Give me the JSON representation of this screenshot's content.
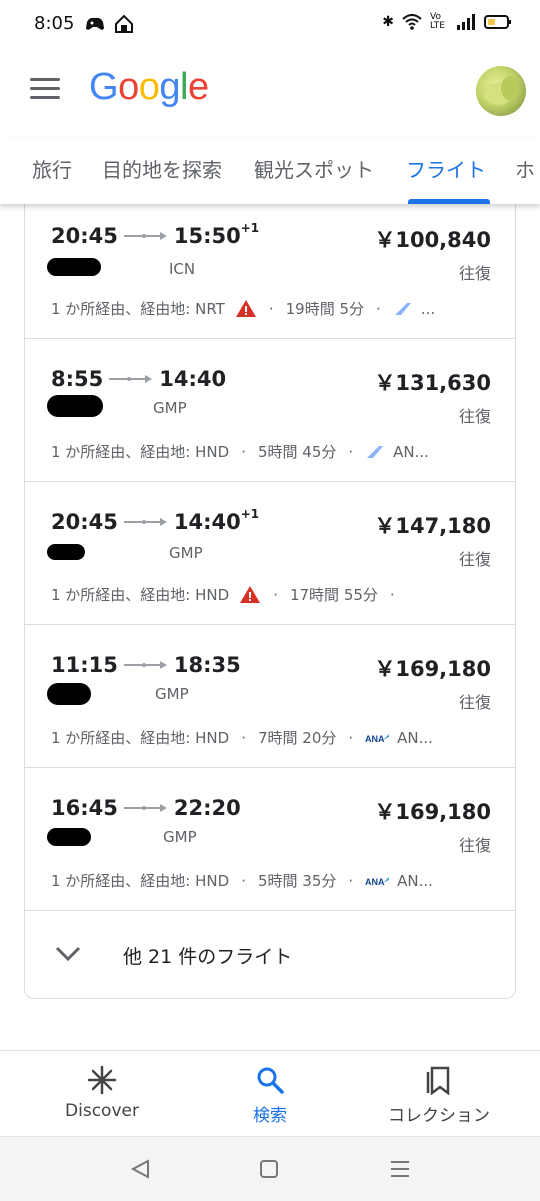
{
  "status_bar": {
    "time": "8:05",
    "network": "Vo LTE"
  },
  "app": {
    "logo_text": [
      "G",
      "o",
      "o",
      "g",
      "l",
      "e"
    ],
    "logo_colors": [
      "#4285F4",
      "#EA4335",
      "#FBBC05",
      "#4285F4",
      "#34A853",
      "#EA4335"
    ]
  },
  "tabs": [
    "旅行",
    "目的地を探索",
    "観光スポット",
    "フライト",
    "ホ"
  ],
  "active_tab": "フライト",
  "flights": [
    {
      "depart": "20:45",
      "arrive": "15:50",
      "plus": "+1",
      "price": "￥100,840",
      "airport": "ICN",
      "trip": "往復",
      "stops": "1 か所経由、経由地: NRT",
      "duration": "19時間 5分",
      "airline": "..."
    },
    {
      "depart": "8:55",
      "arrive": "14:40",
      "plus": "",
      "price": "￥131,630",
      "airport": "GMP",
      "trip": "往復",
      "stops": "1 か所経由、経由地: HND",
      "duration": "5時間 45分",
      "airline": "AN..."
    },
    {
      "depart": "20:45",
      "arrive": "14:40",
      "plus": "+1",
      "price": "￥147,180",
      "airport": "GMP",
      "trip": "往復",
      "stops": "1 か所経由、経由地: HND",
      "duration": "17時間 55分",
      "airline": ""
    },
    {
      "depart": "11:15",
      "arrive": "18:35",
      "plus": "",
      "price": "￥169,180",
      "airport": "GMP",
      "trip": "往復",
      "stops": "1 か所経由、経由地: HND",
      "duration": "7時間 20分",
      "airline": "AN..."
    },
    {
      "depart": "16:45",
      "arrive": "22:20",
      "plus": "",
      "price": "￥169,180",
      "airport": "GMP",
      "trip": "往復",
      "stops": "1 か所経由、経由地: HND",
      "duration": "5時間 35分",
      "airline": "AN..."
    }
  ],
  "more_flights": "他 21 件のフライト",
  "bottom_nav": {
    "discover": "Discover",
    "search": "検索",
    "collections": "コレクション"
  },
  "icons": [
    "menu-icon",
    "avatar",
    "arrow-icon",
    "warning-icon",
    "airline-logo-icon",
    "chevron-down-icon",
    "discover-icon",
    "search-icon",
    "collections-icon",
    "back-icon",
    "home-icon",
    "recents-icon"
  ],
  "colors": {
    "accent": "#1a73e8",
    "warning": "#d93025"
  }
}
